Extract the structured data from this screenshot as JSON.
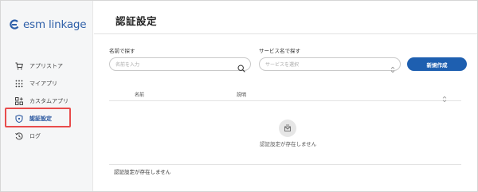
{
  "app": {
    "logo_text": "esm linkage"
  },
  "sidebar": {
    "items": [
      {
        "label": "アプリストア",
        "icon": "cart-icon"
      },
      {
        "label": "マイアプリ",
        "icon": "grid-dots-icon"
      },
      {
        "label": "カスタムアプリ",
        "icon": "apps-plus-icon"
      },
      {
        "label": "認証設定",
        "icon": "shield-icon",
        "active": true
      },
      {
        "label": "ログ",
        "icon": "history-icon"
      }
    ]
  },
  "main": {
    "title": "認証設定",
    "filters": {
      "name_label": "名前で探す",
      "name_placeholder": "名前を入力",
      "service_label": "サービス名で探す",
      "service_placeholder": "サービスを選択"
    },
    "create_button": "新規作成",
    "table": {
      "columns": [
        "名前",
        "説明"
      ],
      "empty_message": "認証設定が存在しません"
    },
    "footer_message": "認証設定が存在しません"
  },
  "colors": {
    "accent": "#1e5fb0",
    "highlight": "#e84c4c",
    "sidebar_bg": "#f5f6f7"
  }
}
